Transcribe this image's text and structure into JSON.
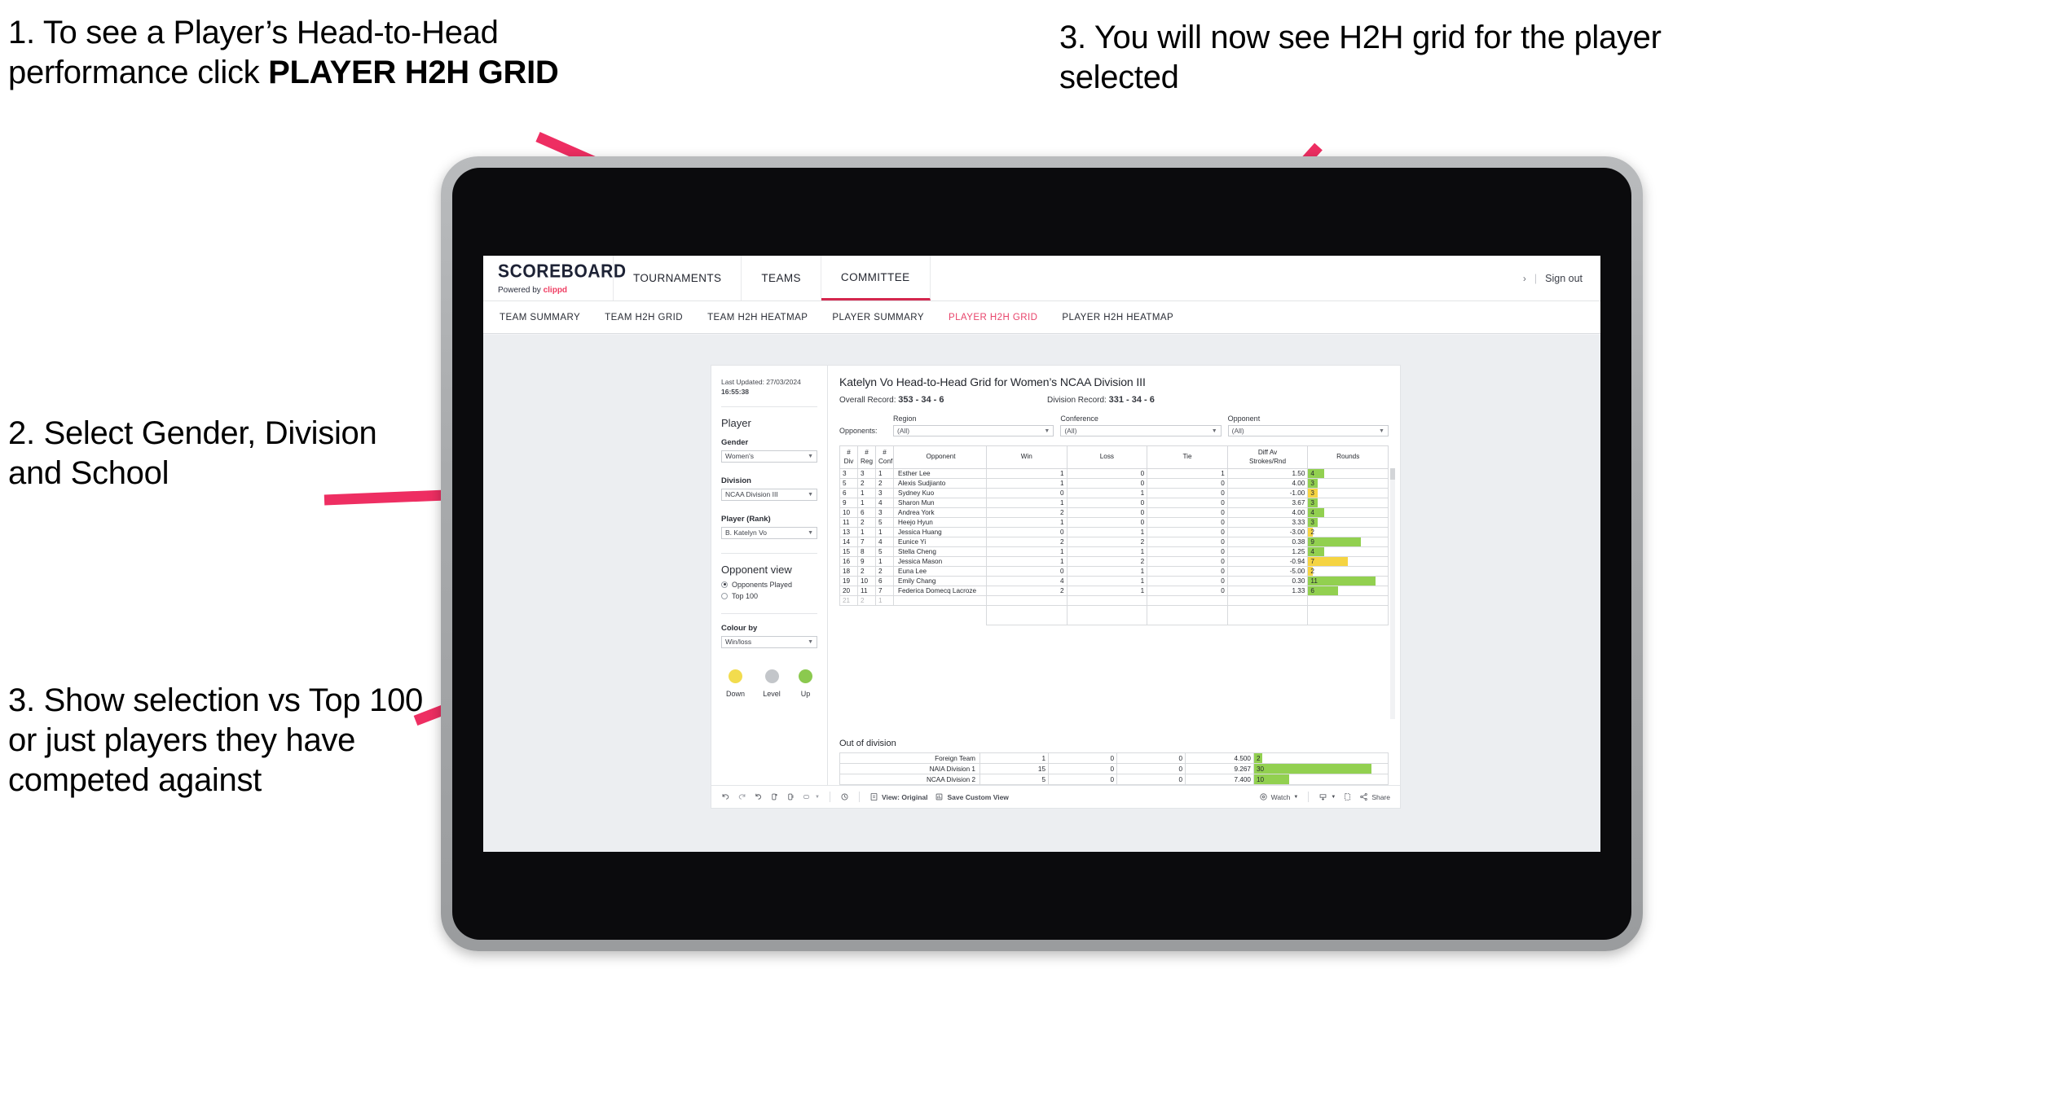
{
  "annotations": {
    "a1_pre": "1. To see a Player’s Head-to-Head performance click ",
    "a1_bold": "PLAYER H2H GRID",
    "a2": "2. Select Gender, Division and School",
    "a3": "3. Show selection vs Top 100 or just players they have competed against",
    "a4": "3. You will now see H2H grid for the player selected",
    "accent_color": "#ee2e62"
  },
  "app": {
    "brand_title": "SCOREBOARD",
    "brand_sub_prefix": "Powered by ",
    "brand_sub_accent": "clippd",
    "topnav": [
      {
        "label": "TOURNAMENTS",
        "active": false
      },
      {
        "label": "TEAMS",
        "active": false
      },
      {
        "label": "COMMITTEE",
        "active": true
      }
    ],
    "account": {
      "chevron": "›",
      "divider": "|",
      "sign_out": "Sign out"
    },
    "subnav": [
      {
        "label": "TEAM SUMMARY",
        "active": false
      },
      {
        "label": "TEAM H2H GRID",
        "active": false
      },
      {
        "label": "TEAM H2H HEATMAP",
        "active": false
      },
      {
        "label": "PLAYER SUMMARY",
        "active": false
      },
      {
        "label": "PLAYER H2H GRID",
        "active": true
      },
      {
        "label": "PLAYER H2H HEATMAP",
        "active": false
      }
    ],
    "active_tab_color": "#e8446b"
  },
  "filters": {
    "last_updated_label": "Last Updated: 27/03/2024",
    "last_updated_time": "16:55:38",
    "player_section_title": "Player",
    "gender_label": "Gender",
    "gender_value": "Women's",
    "division_label": "Division",
    "division_value": "NCAA Division III",
    "player_rank_label": "Player (Rank)",
    "player_rank_value": "B. Katelyn Vo",
    "opponent_view_title": "Opponent view",
    "opponent_view_options": [
      {
        "label": "Opponents Played",
        "selected": true
      },
      {
        "label": "Top 100",
        "selected": false
      }
    ],
    "colour_by_label": "Colour by",
    "colour_by_value": "Win/loss",
    "legend": [
      {
        "label": "Down",
        "color": "#f2dc4e"
      },
      {
        "label": "Level",
        "color": "#c3c6ca"
      },
      {
        "label": "Up",
        "color": "#8bc94f"
      }
    ]
  },
  "viz": {
    "title": "Katelyn Vo Head-to-Head Grid for Women’s NCAA Division III",
    "overall_record_label": "Overall Record:",
    "overall_record_value": "353 - 34 - 6",
    "division_record_label": "Division Record:",
    "division_record_value": "331 - 34 - 6",
    "opponents_label": "Opponents:",
    "opponent_filters": [
      {
        "caption": "Region",
        "value": "(All)"
      },
      {
        "caption": "Conference",
        "value": "(All)"
      },
      {
        "caption": "Opponent",
        "value": "(All)"
      }
    ],
    "out_of_division_title": "Out of division"
  },
  "chart_data": {
    "type": "table",
    "title": "Katelyn Vo Head-to-Head Grid for Women’s NCAA Division III",
    "columns": [
      "# Div",
      "# Reg",
      "# Conf",
      "Opponent",
      "Win",
      "Loss",
      "Tie",
      "Diff Av Strokes/Rnd",
      "Rounds"
    ],
    "column_header_lines": [
      [
        "#",
        "Div"
      ],
      [
        "#",
        "Reg"
      ],
      [
        "#",
        "Conf"
      ],
      [
        "Opponent",
        ""
      ],
      [
        "Win",
        ""
      ],
      [
        "Loss",
        ""
      ],
      [
        "Tie",
        ""
      ],
      [
        "Diff Av",
        "Strokes/Rnd"
      ],
      [
        "Rounds",
        ""
      ]
    ],
    "rows": [
      {
        "div": "3",
        "reg": "3",
        "conf": "1",
        "opponent": "Esther Lee",
        "win": "1",
        "loss": "0",
        "tie": "1",
        "diff": "1.50",
        "rounds": "4",
        "state": "up",
        "rounds_pct": 20
      },
      {
        "div": "5",
        "reg": "2",
        "conf": "2",
        "opponent": "Alexis Sudjianto",
        "win": "1",
        "loss": "0",
        "tie": "0",
        "diff": "4.00",
        "rounds": "3",
        "state": "up",
        "rounds_pct": 12
      },
      {
        "div": "6",
        "reg": "1",
        "conf": "3",
        "opponent": "Sydney Kuo",
        "win": "0",
        "loss": "1",
        "tie": "0",
        "diff": "-1.00",
        "rounds": "3",
        "state": "down",
        "rounds_pct": 12
      },
      {
        "div": "9",
        "reg": "1",
        "conf": "4",
        "opponent": "Sharon Mun",
        "win": "1",
        "loss": "0",
        "tie": "0",
        "diff": "3.67",
        "rounds": "3",
        "state": "up",
        "rounds_pct": 12
      },
      {
        "div": "10",
        "reg": "6",
        "conf": "3",
        "opponent": "Andrea York",
        "win": "2",
        "loss": "0",
        "tie": "0",
        "diff": "4.00",
        "rounds": "4",
        "state": "up",
        "rounds_pct": 20
      },
      {
        "div": "11",
        "reg": "2",
        "conf": "5",
        "opponent": "Heejo Hyun",
        "win": "1",
        "loss": "0",
        "tie": "0",
        "diff": "3.33",
        "rounds": "3",
        "state": "up",
        "rounds_pct": 12
      },
      {
        "div": "13",
        "reg": "1",
        "conf": "1",
        "opponent": "Jessica Huang",
        "win": "0",
        "loss": "1",
        "tie": "0",
        "diff": "-3.00",
        "rounds": "2",
        "state": "down",
        "rounds_pct": 6
      },
      {
        "div": "14",
        "reg": "7",
        "conf": "4",
        "opponent": "Eunice Yi",
        "win": "2",
        "loss": "2",
        "tie": "0",
        "diff": "0.38",
        "rounds": "9",
        "state": "level",
        "diff_state": "up",
        "rounds_pct": 66
      },
      {
        "div": "15",
        "reg": "8",
        "conf": "5",
        "opponent": "Stella Cheng",
        "win": "1",
        "loss": "1",
        "tie": "0",
        "diff": "1.25",
        "rounds": "4",
        "state": "level",
        "diff_state": "up",
        "rounds_pct": 20
      },
      {
        "div": "16",
        "reg": "9",
        "conf": "1",
        "opponent": "Jessica Mason",
        "win": "1",
        "loss": "2",
        "tie": "0",
        "diff": "-0.94",
        "rounds": "7",
        "state": "down",
        "rounds_pct": 50
      },
      {
        "div": "18",
        "reg": "2",
        "conf": "2",
        "opponent": "Euna Lee",
        "win": "0",
        "loss": "1",
        "tie": "0",
        "diff": "-5.00",
        "rounds": "2",
        "state": "down",
        "rounds_pct": 6
      },
      {
        "div": "19",
        "reg": "10",
        "conf": "6",
        "opponent": "Emily Chang",
        "win": "4",
        "loss": "1",
        "tie": "0",
        "diff": "0.30",
        "rounds": "11",
        "state": "up",
        "rounds_pct": 85
      },
      {
        "div": "20",
        "reg": "11",
        "conf": "7",
        "opponent": "Federica Domecq Lacroze",
        "win": "2",
        "loss": "1",
        "tie": "0",
        "diff": "1.33",
        "rounds": "6",
        "state": "up",
        "rounds_pct": 38
      }
    ],
    "out_of_division_rows": [
      {
        "name": "Foreign Team",
        "win": "1",
        "loss": "0",
        "tie": "0",
        "diff": "4.500",
        "rounds": "2",
        "state": "up",
        "rounds_pct": 6
      },
      {
        "name": "NAIA Division 1",
        "win": "15",
        "loss": "0",
        "tie": "0",
        "diff": "9.267",
        "rounds": "30",
        "state": "up",
        "rounds_pct": 88
      },
      {
        "name": "NCAA Division 2",
        "win": "5",
        "loss": "0",
        "tie": "0",
        "diff": "7.400",
        "rounds": "10",
        "state": "up",
        "rounds_pct": 26
      }
    ],
    "colors": {
      "up": "#92d050",
      "down": "#f5d442",
      "level": "#cfd1d4"
    }
  },
  "toolbar": {
    "undo": "undo-icon",
    "redo": "redo-icon",
    "revert": "revert-icon",
    "refresh": "refresh-icon",
    "pause": "pause-icon",
    "view_label": "View: Original",
    "save_custom_view_label": "Save Custom View",
    "watch_label": "Watch",
    "share_label": "Share"
  }
}
